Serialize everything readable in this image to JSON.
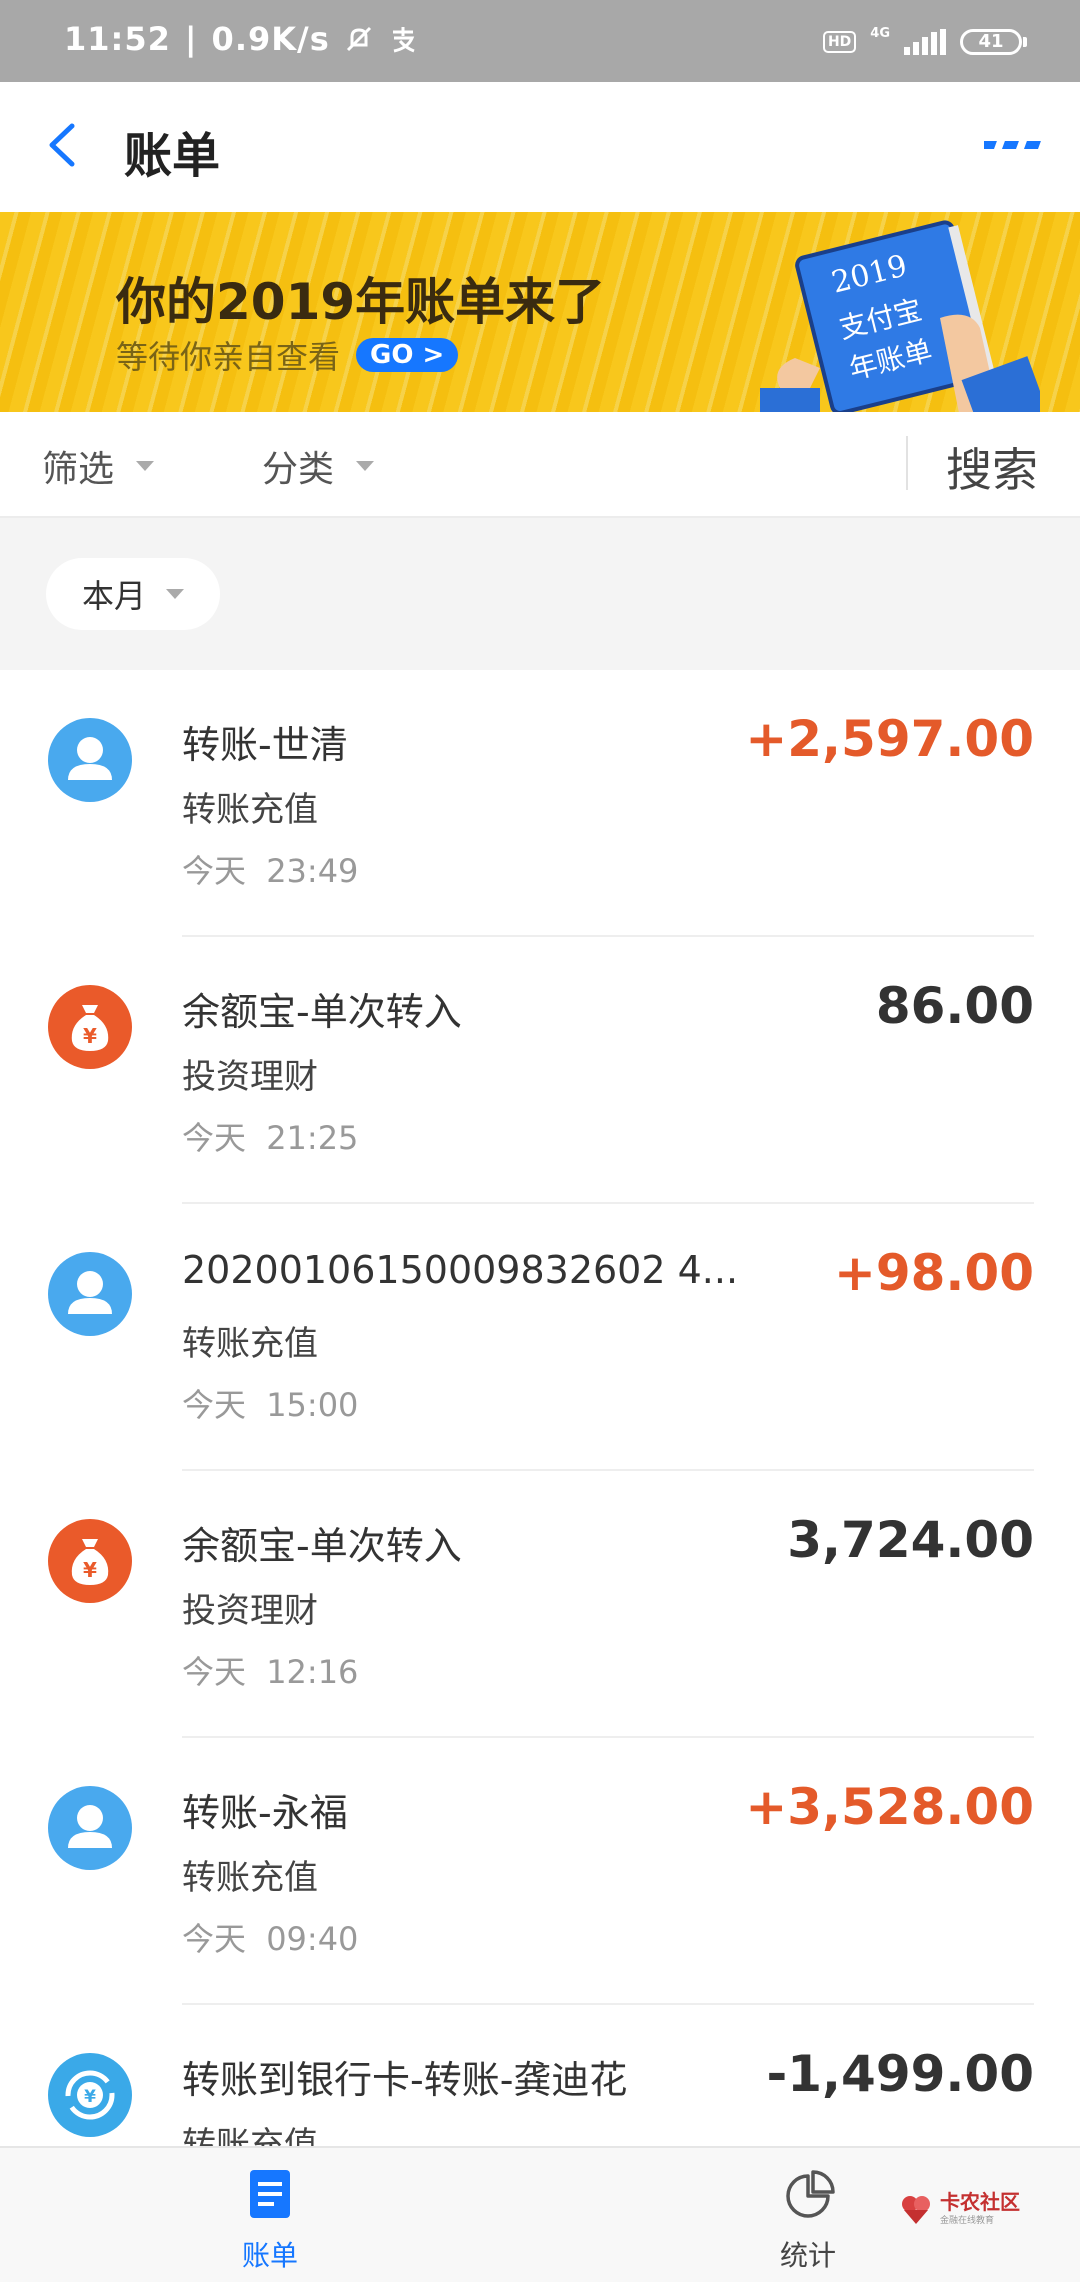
{
  "status_bar": {
    "time": "11:52",
    "speed": "0.9K/s",
    "hd": "HD",
    "network": "4G",
    "battery": "41"
  },
  "header": {
    "title": "账单"
  },
  "banner": {
    "title": "你的2019年账单来了",
    "subtitle": "等待你亲自查看",
    "go_label": "GO >",
    "book_text": [
      "2019",
      "支付宝",
      "年账单"
    ]
  },
  "filters": {
    "filter_label": "筛选",
    "category_label": "分类",
    "search_label": "搜索"
  },
  "month": {
    "label": "本月"
  },
  "transactions": [
    {
      "title": "转账-世清",
      "category": "转账充值",
      "day": "今天",
      "time": "23:49",
      "amount": "+2,597.00",
      "type": "income",
      "icon": "person-icon"
    },
    {
      "title": "余额宝-单次转入",
      "category": "投资理财",
      "day": "今天",
      "time": "21:25",
      "amount": "86.00",
      "type": "neutral",
      "icon": "money-bag-icon"
    },
    {
      "title": "20200106150009832602 4...",
      "category": "转账充值",
      "day": "今天",
      "time": "15:00",
      "amount": "+98.00",
      "type": "income",
      "icon": "person-icon"
    },
    {
      "title": "余额宝-单次转入",
      "category": "投资理财",
      "day": "今天",
      "time": "12:16",
      "amount": "3,724.00",
      "type": "neutral",
      "icon": "money-bag-icon"
    },
    {
      "title": "转账-永福",
      "category": "转账充值",
      "day": "今天",
      "time": "09:40",
      "amount": "+3,528.00",
      "type": "income",
      "icon": "person-icon"
    },
    {
      "title": "转账到银行卡-转账-龚迪花",
      "category": "转账充值",
      "day": "",
      "time": "",
      "amount": "-1,499.00",
      "type": "neutral",
      "icon": "bank-transfer-icon"
    }
  ],
  "bottom_nav": {
    "bills_label": "账单",
    "stats_label": "统计"
  },
  "watermark": {
    "text": "卡农社区",
    "sub": "金融在线教育"
  },
  "colors": {
    "accent": "#1677ff",
    "income": "#e45a2a",
    "banner": "#f8c71c"
  }
}
